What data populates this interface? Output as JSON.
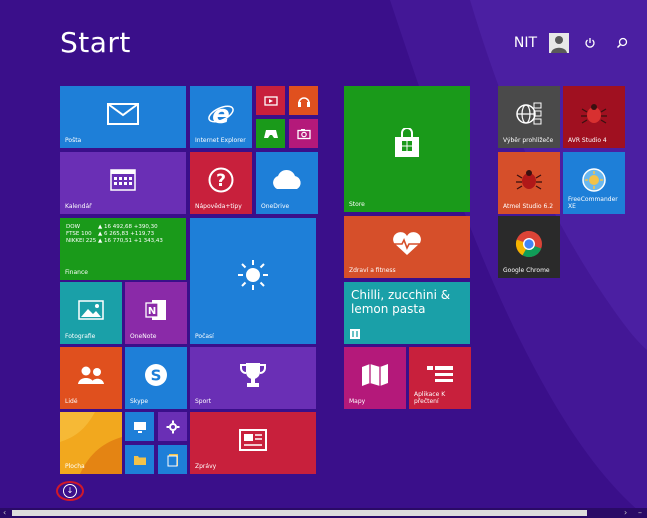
{
  "screen": {
    "title": "Start"
  },
  "user": {
    "name": "NIT"
  },
  "tiles": {
    "posta": "Pošta",
    "ie": "Internet Explorer",
    "kalendar": "Kalendář",
    "napoveda": "Nápověda+tipy",
    "onedrive": "OneDrive",
    "finance": "Finance",
    "fotografie": "Fotografie",
    "onenote": "OneNote",
    "pocasi": "Počasí",
    "lide": "Lidé",
    "skype": "Skype",
    "sport": "Sport",
    "plocha": "Plocha",
    "zpravy": "Zprávy",
    "store": "Store",
    "zdravi": "Zdraví a fitness",
    "food_title": "Chilli, zucchini & lemon pasta",
    "mapy": "Mapy",
    "aplikace": "Aplikace K přečtení",
    "vyber": "Výběr prohlížeče",
    "avr": "AVR Studio 4",
    "atmel": "Atmel Studio 6.2",
    "freecommander": "FreeCommander XE",
    "chrome": "Google Chrome"
  },
  "finance_rows": [
    {
      "name": "DOW",
      "value": "▲ 16 492,68 +390,30"
    },
    {
      "name": "FTSE 100",
      "value": "▲ 6 265,83 +119,73"
    },
    {
      "name": "NIKKEI 225",
      "value": "▲ 16 770,51 +1 343,43"
    }
  ],
  "colors": {
    "background": "#3a0f8a",
    "blue": "#1e7fd8",
    "purple": "#6a2fb5",
    "green": "#1a9a1a",
    "red": "#c8203c",
    "orange": "#d64f2a",
    "teal": "#1aa0a8",
    "magenta": "#b4197a",
    "dark": "#2a2a2a"
  }
}
